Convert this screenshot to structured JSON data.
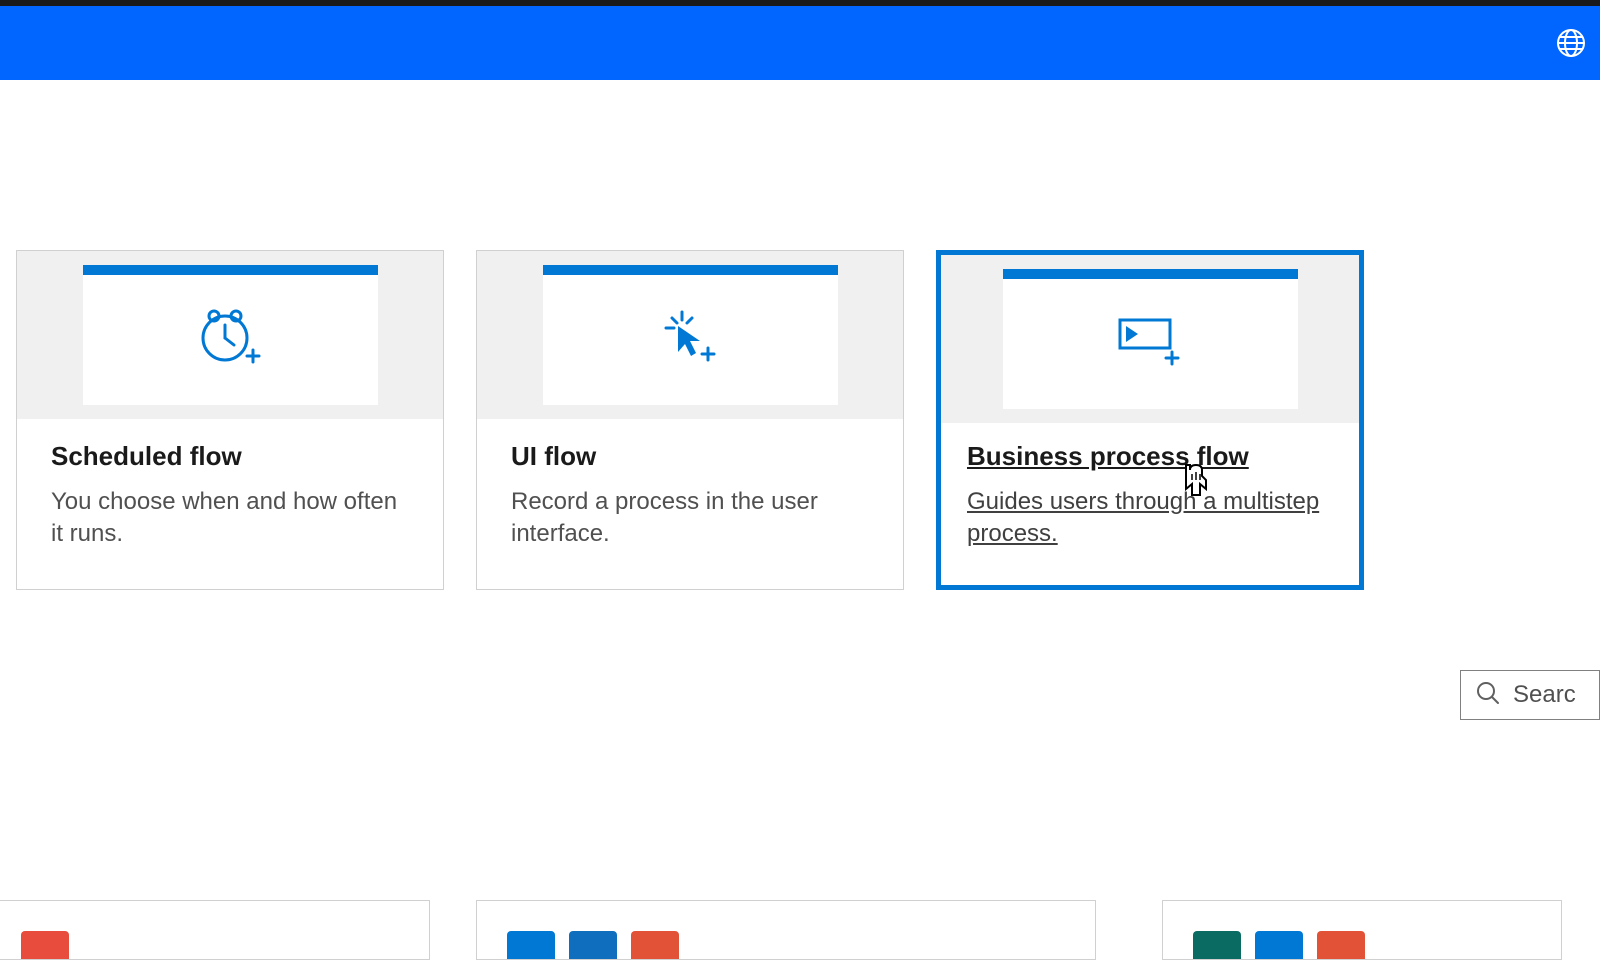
{
  "header": {
    "globe_icon": "globe-icon"
  },
  "cards": [
    {
      "title": "Scheduled flow",
      "description": "You choose when and how often it runs.",
      "icon": "clock-plus"
    },
    {
      "title": "UI flow",
      "description": "Record a process in the user interface.",
      "icon": "cursor-plus"
    },
    {
      "title": "Business process flow",
      "description": "Guides users through a multistep process.",
      "icon": "step-plus",
      "selected": true
    }
  ],
  "search": {
    "placeholder": "Searc"
  }
}
